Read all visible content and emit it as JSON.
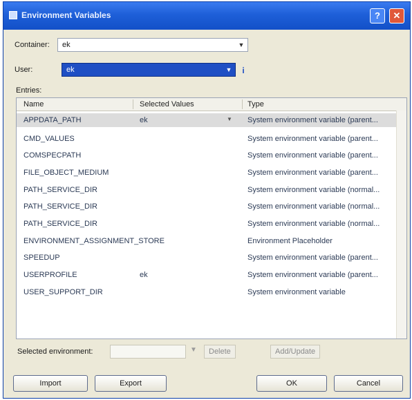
{
  "window": {
    "title": "Environment Variables",
    "help_glyph": "?",
    "close_glyph": "✕"
  },
  "fields": {
    "container_label": "Container:",
    "container_value": "ek",
    "user_label": "User:",
    "user_value": "ek",
    "info_glyph": "i",
    "section_label": "Entries:"
  },
  "list": {
    "columns": [
      "Name",
      "Selected Values",
      "Type"
    ],
    "rows": [
      {
        "name": "APPDATA_PATH",
        "value": "ek",
        "type": "System environment variable (parent...",
        "selected": true
      },
      {
        "name": "CMD_VALUES",
        "value": "",
        "type": "System environment variable (parent..."
      },
      {
        "name": "COMSPECPATH",
        "value": "",
        "type": "System environment variable (parent..."
      },
      {
        "name": "FILE_OBJECT_MEDIUM",
        "value": "",
        "type": "System environment variable (parent..."
      },
      {
        "name": "PATH_SERVICE_DIR",
        "value": "",
        "type": "System environment variable (normal..."
      },
      {
        "name": "PATH_SERVICE_DIR",
        "value": "",
        "type": "System environment variable (normal..."
      },
      {
        "name": "PATH_SERVICE_DIR",
        "value": "",
        "type": "System environment variable (normal..."
      },
      {
        "name": "ENVIRONMENT_ASSIGNMENT_STORE",
        "value": "",
        "type": "Environment Placeholder"
      },
      {
        "name": "SPEEDUP",
        "value": "",
        "type": "System environment variable (parent..."
      },
      {
        "name": "USERPROFILE",
        "value": "ek",
        "type": "System environment variable (parent..."
      },
      {
        "name": "USER_SUPPORT_DIR",
        "value": "",
        "type": "System environment variable"
      }
    ],
    "dropdown_glyph": "▼"
  },
  "assignment": {
    "label": "Selected environment:",
    "input_value": "",
    "btn1": "Delete",
    "btn2": "Add/Update"
  },
  "buttons": {
    "import": "Import",
    "export": "Export",
    "ok": "OK",
    "cancel": "Cancel"
  }
}
